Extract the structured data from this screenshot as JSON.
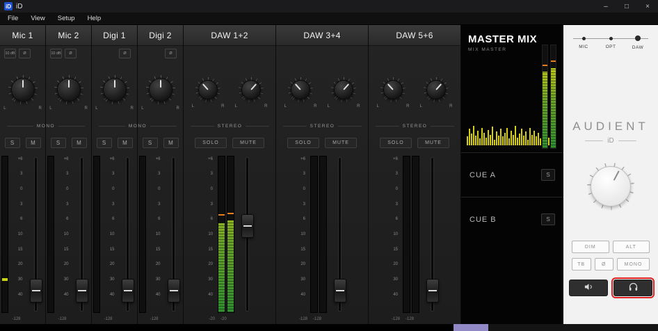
{
  "window": {
    "icon_label": "iD",
    "title": "iD",
    "minimize_icon": "–",
    "maximize_icon": "□",
    "close_icon": "×"
  },
  "menu": [
    "File",
    "View",
    "Setup",
    "Help"
  ],
  "labels": {
    "pan_left": "L",
    "pan_right": "R"
  },
  "fader_scale": [
    "+6",
    "3",
    "0",
    "3",
    "6",
    "10",
    "15",
    "20",
    "30",
    "40"
  ],
  "channel_groups": [
    {
      "link_label": "MONO",
      "stereo": false,
      "channels": [
        {
          "name": "Mic 1",
          "buttons": [
            "10 dB",
            "Ø"
          ],
          "pan": 0,
          "solo": "S",
          "mute": "M",
          "meter": 0,
          "mark": 0.2,
          "fader": 0.92,
          "readout": "-128"
        },
        {
          "name": "Mic 2",
          "buttons": [
            "10 dB",
            "Ø"
          ],
          "pan": 0,
          "solo": "S",
          "mute": "M",
          "meter": 0,
          "fader": 0.92,
          "readout": "-128"
        }
      ]
    },
    {
      "link_label": "MONO",
      "stereo": false,
      "channels": [
        {
          "name": "Digi 1",
          "buttons": [
            "Ø"
          ],
          "pan": 0,
          "solo": "S",
          "mute": "M",
          "meter": 0,
          "fader": 0.92,
          "readout": "-128"
        },
        {
          "name": "Digi 2",
          "buttons": [
            "Ø"
          ],
          "pan": 0,
          "solo": "S",
          "mute": "M",
          "meter": 0,
          "fader": 0.92,
          "readout": "-128"
        }
      ]
    },
    {
      "link_label": "STEREO",
      "stereo": true,
      "channels": [
        {
          "name": "DAW 1+2",
          "solo": "SOLO",
          "mute": "MUTE",
          "pans": [
            -42,
            42
          ],
          "meters": [
            0.57,
            0.59
          ],
          "peaks": [
            0.62,
            0.63
          ],
          "fader": 0.44,
          "readouts": [
            "-20",
            "-20"
          ]
        }
      ]
    },
    {
      "link_label": "STEREO",
      "stereo": true,
      "channels": [
        {
          "name": "DAW 3+4",
          "solo": "SOLO",
          "mute": "MUTE",
          "pans": [
            -42,
            42
          ],
          "meters": [
            0,
            0
          ],
          "fader": 0.92,
          "readouts": [
            "-128",
            "-128"
          ]
        }
      ]
    },
    {
      "link_label": "STEREO",
      "stereo": true,
      "channels": [
        {
          "name": "DAW 5+6",
          "solo": "SOLO",
          "mute": "MUTE",
          "pans": [
            -42,
            42
          ],
          "meters": [
            0,
            0
          ],
          "fader": 0.92,
          "readouts": [
            "-128",
            "-128"
          ]
        }
      ]
    }
  ],
  "master": {
    "title": "MASTER MIX",
    "subtitle": "MIX MASTER",
    "meters": [
      {
        "fill": 0.74,
        "peak": 0.8
      },
      {
        "fill": 0.78,
        "peak": 0.84
      }
    ],
    "spectrum": [
      0.45,
      0.85,
      0.6,
      1,
      0.5,
      0.75,
      0.35,
      0.9,
      0.65,
      0.4,
      0.8,
      0.55,
      0.95,
      0.3,
      0.7,
      0.5,
      0.85,
      0.45,
      0.65,
      0.9,
      0.35,
      0.75,
      0.55,
      1,
      0.4,
      0.6,
      0.85,
      0.5,
      0.7,
      0.3,
      0.9,
      0.55,
      0.75,
      0.45,
      0.65,
      0.35,
      0.8,
      0.5,
      0.6,
      0.4,
      0.7,
      0.45,
      0.55
    ],
    "cues": [
      {
        "label": "CUE A",
        "solo": "S"
      },
      {
        "label": "CUE B",
        "solo": "S"
      }
    ]
  },
  "monitor": {
    "sources": [
      {
        "label": "MIC",
        "active": false
      },
      {
        "label": "OPT",
        "active": false
      },
      {
        "label": "DAW",
        "active": true
      }
    ],
    "brand": "AUDIENT",
    "brand_sub": "iD",
    "knob_angle": 28,
    "row1": [
      "DIM",
      "ALT"
    ],
    "row2": [
      "TB",
      "Ø",
      "MONO"
    ],
    "outputs": [
      {
        "icon": "speaker",
        "highlight": false
      },
      {
        "icon": "headphones",
        "highlight": true
      }
    ]
  }
}
